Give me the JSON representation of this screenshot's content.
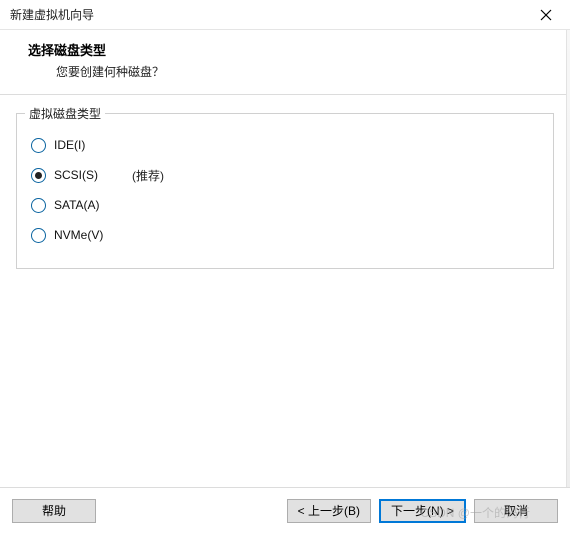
{
  "titlebar": {
    "title": "新建虚拟机向导"
  },
  "header": {
    "title": "选择磁盘类型",
    "subtitle": "您要创建何种磁盘？"
  },
  "group": {
    "legend": "虚拟磁盘类型",
    "options": [
      {
        "label": "IDE(I)",
        "hint": "",
        "selected": false
      },
      {
        "label": "SCSI(S)",
        "hint": "(推荐)",
        "selected": true
      },
      {
        "label": "SATA(A)",
        "hint": "",
        "selected": false
      },
      {
        "label": "NVMe(V)",
        "hint": "",
        "selected": false
      }
    ]
  },
  "footer": {
    "help": "帮助",
    "back": "< 上一步(B)",
    "next": "下一步(N) >",
    "cancel": "取消"
  },
  "watermark": "CSDN @一个的码行"
}
